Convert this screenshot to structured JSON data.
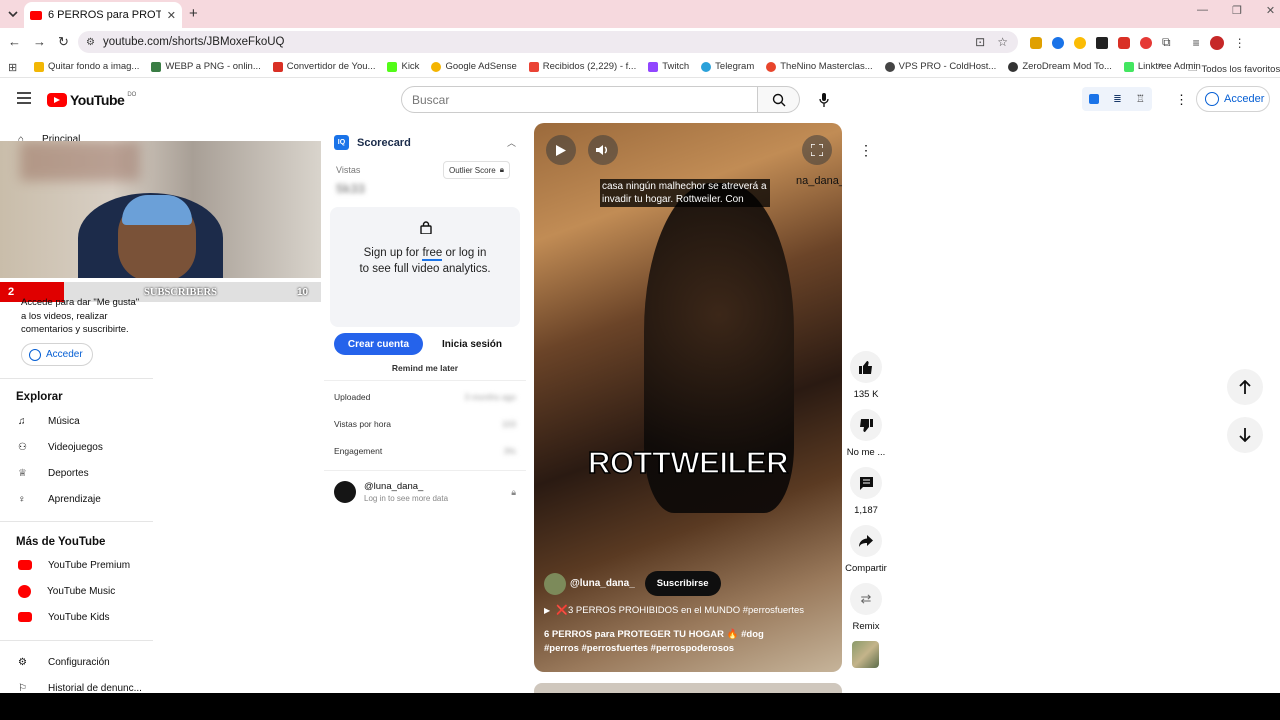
{
  "browser": {
    "tab_title": "6 PERROS para PROTEGER TU H",
    "url": "youtube.com/shorts/JBMoxeFkoUQ",
    "bookmarks": [
      {
        "label": "Quitar fondo a imag...",
        "color": "#f2b705"
      },
      {
        "label": "WEBP a PNG - onlin...",
        "color": "#3a7d44"
      },
      {
        "label": "Convertidor de You...",
        "color": "#d93025"
      },
      {
        "label": "Kick",
        "color": "#53fc18"
      },
      {
        "label": "Google AdSense",
        "color": "#f4b400"
      },
      {
        "label": "Recibidos (2,229) - f...",
        "color": "#ea4335"
      },
      {
        "label": "Twitch",
        "color": "#9146ff"
      },
      {
        "label": "Telegram",
        "color": "#2aa1da"
      },
      {
        "label": "TheNino Masterclas...",
        "color": "#e8452c"
      },
      {
        "label": "VPS PRO - ColdHost...",
        "color": "#444"
      },
      {
        "label": "ZeroDream Mod To...",
        "color": "#333"
      },
      {
        "label": "Linktree Admin",
        "color": "#43e660"
      }
    ],
    "all_bookmarks": "Todos los favoritos"
  },
  "header": {
    "logo": "YouTube",
    "region": "DO",
    "search_placeholder": "Buscar",
    "sign_in": "Acceder"
  },
  "sidebar": {
    "home": "Principal",
    "signin_prompt": "Accede para dar \"Me gusta\" a los videos, realizar comentarios y suscribirte.",
    "signin_button": "Acceder",
    "explore_title": "Explorar",
    "explore": [
      {
        "label": "Música",
        "icon": "music-note-icon"
      },
      {
        "label": "Videojuegos",
        "icon": "gamepad-icon"
      },
      {
        "label": "Deportes",
        "icon": "trophy-icon"
      },
      {
        "label": "Aprendizaje",
        "icon": "lightbulb-icon"
      }
    ],
    "more_title": "Más de YouTube",
    "more": [
      {
        "label": "YouTube Premium",
        "icon": "youtube-premium-icon"
      },
      {
        "label": "YouTube Music",
        "icon": "youtube-music-icon"
      },
      {
        "label": "YouTube Kids",
        "icon": "youtube-kids-icon"
      }
    ],
    "settings": "Configuración",
    "report_history": "Historial de denunc..."
  },
  "overlay": {
    "subs_left": "2",
    "subs_label": "SUBSCRIBERS",
    "subs_right": "10"
  },
  "scorecard": {
    "title": "Scorecard",
    "views_label": "Vistas",
    "views_value": "5k33",
    "outlier_label": "Outlier Score",
    "signup_line1_a": "Sign up for ",
    "signup_free": "free",
    "signup_line1_b": " or log in",
    "signup_line2": "to see full video analytics.",
    "create_account": "Crear cuenta",
    "login": "Inicia sesión",
    "remind": "Remind me later",
    "rows": [
      {
        "label": "Uploaded",
        "value": "3 months ago"
      },
      {
        "label": "Vistas por hora",
        "value": "103"
      },
      {
        "label": "Engagement",
        "value": "3%"
      }
    ],
    "channel": "@luna_dana_",
    "channel_sub": "Log in to see more data"
  },
  "video": {
    "caption": "casa ningún malhechor se atreverá a invadir tu hogar. Rottweiler. Con",
    "watermark": "na_dana_",
    "big_text": "ROTTWEILER",
    "channel": "@luna_dana_",
    "subscribe": "Suscribirse",
    "playlist": "❌3 PERROS PROHIBIDOS en el MUNDO #perrosfuertes",
    "title": "6 PERROS para PROTEGER TU HOGAR 🔥 #dog #perros #perrosfuertes #perrospoderosos"
  },
  "actions": {
    "likes": "135 K",
    "dislike": "No me ...",
    "comments": "1,187",
    "share": "Compartir",
    "remix": "Remix"
  }
}
